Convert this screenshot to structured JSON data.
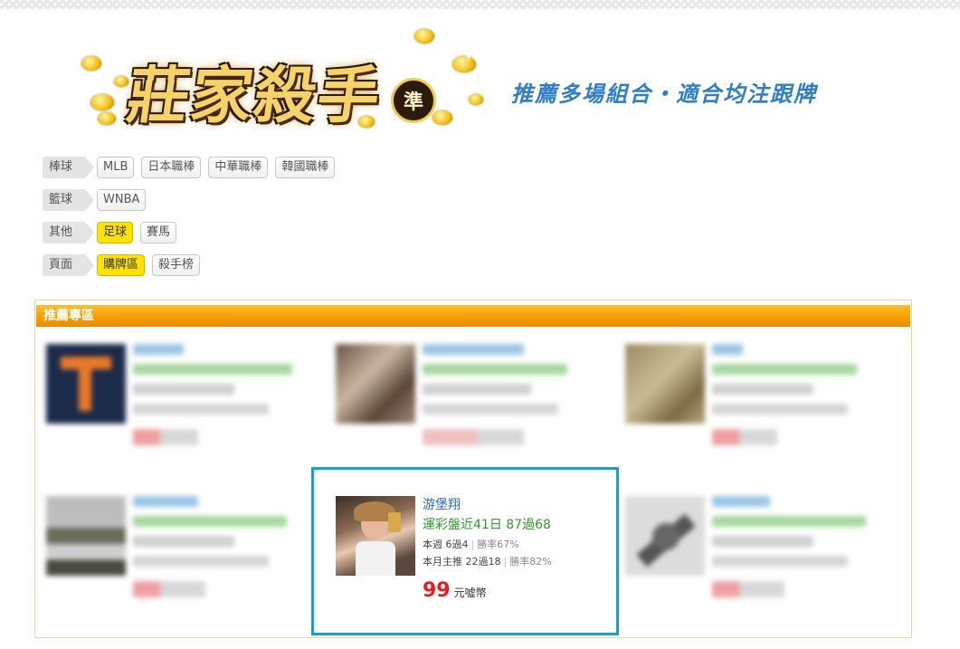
{
  "logo": {
    "title": "莊家殺手",
    "badge": "準",
    "slogan": "推薦多場組合・適合均注跟牌"
  },
  "categories": [
    {
      "label": "棒球",
      "tags": [
        {
          "text": "MLB",
          "active": false
        },
        {
          "text": "日本職棒",
          "active": false
        },
        {
          "text": "中華職棒",
          "active": false
        },
        {
          "text": "韓國職棒",
          "active": false
        }
      ]
    },
    {
      "label": "籃球",
      "tags": [
        {
          "text": "WNBA",
          "active": false
        }
      ]
    },
    {
      "label": "其他",
      "tags": [
        {
          "text": "足球",
          "active": true
        },
        {
          "text": "賽馬",
          "active": false
        }
      ]
    },
    {
      "label": "頁面",
      "tags": [
        {
          "text": "購牌區",
          "active": true
        },
        {
          "text": "殺手榜",
          "active": false
        }
      ]
    }
  ],
  "panel": {
    "title": "推薦專區"
  },
  "featured": {
    "name": "游堡翔",
    "record": "運彩盤近41日 87過68",
    "week": "本週 6過4",
    "week_rate": "勝率67%",
    "month": "本月主推 22過18",
    "month_rate": "勝率82%",
    "price": "99",
    "unit": "元噓幣"
  },
  "colors": {
    "accent": "#f39e00",
    "highlight": "#ffe200",
    "name": "#2b6bb0",
    "record": "#2f9a29",
    "price": "#e02020",
    "selection": "#15a1c8"
  }
}
